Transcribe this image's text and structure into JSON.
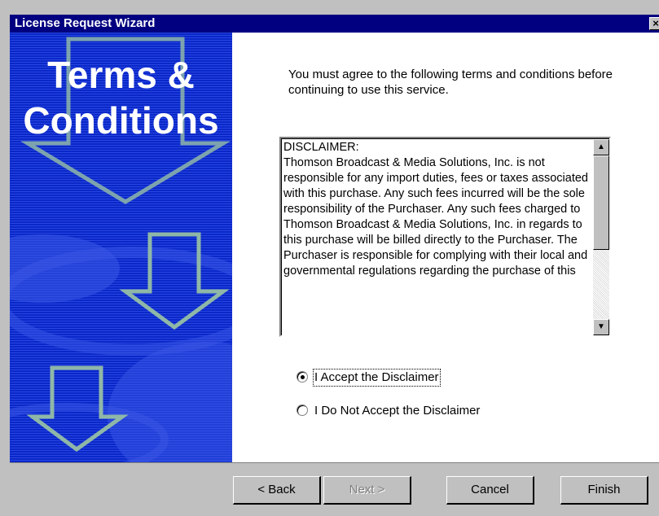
{
  "window": {
    "title": "License Request Wizard",
    "close_label": "×"
  },
  "banner": {
    "title_line1": "Terms &",
    "title_line2": "Conditions"
  },
  "intro_text": "You must agree to the following terms and conditions before continuing to use this service.",
  "disclaimer": {
    "text": "DISCLAIMER:\nThomson Broadcast & Media Solutions, Inc. is not responsible for any import duties, fees or taxes associated with this purchase.  Any such fees incurred will be the sole responsibility of the Purchaser.  Any such fees charged to Thomson Broadcast & Media Solutions, Inc. in regards to this purchase will be billed directly to the Purchaser.  The Purchaser is responsible for complying with their local and governmental regulations regarding the purchase of this",
    "scroll_up": "▲",
    "scroll_down": "▼"
  },
  "options": {
    "accept_label": "I Accept the Disclaimer",
    "accept_checked": true,
    "decline_label": "I Do Not Accept the Disclaimer",
    "decline_checked": false
  },
  "buttons": {
    "back": "< Back",
    "next": "Next >",
    "cancel": "Cancel",
    "finish": "Finish"
  },
  "colors": {
    "titlebar": "#000080",
    "banner": "#0a27c8",
    "arrow": "#8fb7a8"
  }
}
